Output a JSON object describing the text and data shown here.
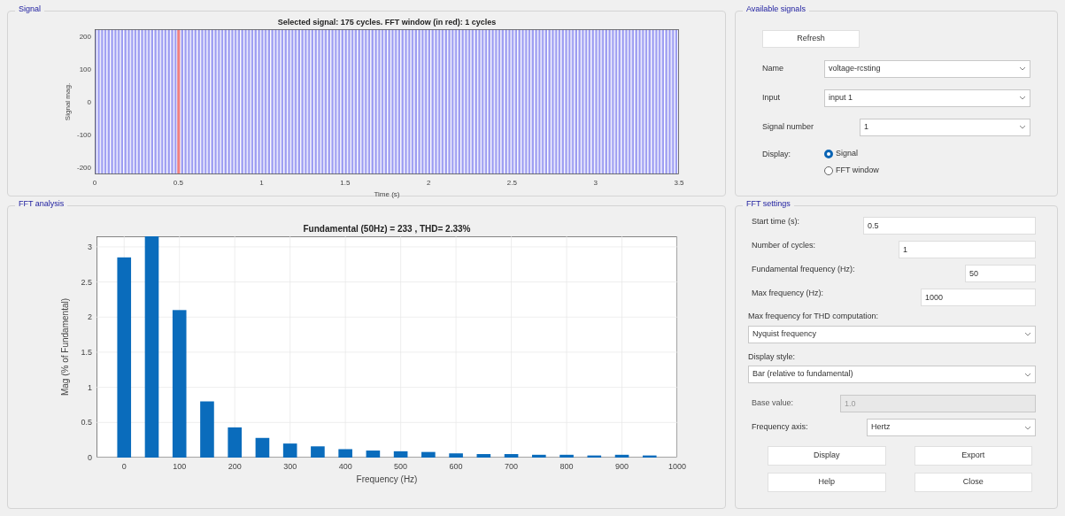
{
  "signal_panel": {
    "title": "Signal",
    "plot": {
      "title": "Selected signal: 175 cycles. FFT window (in red): 1 cycles",
      "ylabel": "Signal mag.",
      "xlabel": "Time (s)",
      "yticks": [
        "200",
        "100",
        "0",
        "-100",
        "-200"
      ],
      "xticks": [
        "0",
        "0.5",
        "1",
        "1.5",
        "2",
        "2.5",
        "3",
        "3.5"
      ]
    }
  },
  "available_signals": {
    "title": "Available signals",
    "refresh": "Refresh",
    "fields": [
      {
        "label": "Name",
        "value": "voltage-rcsting"
      },
      {
        "label": "Input",
        "value": "input 1"
      },
      {
        "label": "Signal number",
        "value": "1"
      }
    ],
    "display_label": "Display:",
    "display_options": [
      {
        "label": "Signal",
        "selected": true
      },
      {
        "label": "FFT window",
        "selected": false
      }
    ]
  },
  "fft_analysis": {
    "title": "FFT analysis",
    "chart_data": {
      "type": "bar",
      "title": "Fundamental (50Hz) = 233 , THD= 2.33%",
      "xlabel": "Frequency (Hz)",
      "ylabel": "Mag (% of Fundamental)",
      "x": [
        0,
        50,
        100,
        150,
        200,
        250,
        300,
        350,
        400,
        450,
        500,
        550,
        600,
        650,
        700,
        750,
        800,
        850,
        900,
        950
      ],
      "values": [
        2.85,
        3.15,
        2.1,
        0.8,
        0.43,
        0.28,
        0.2,
        0.16,
        0.12,
        0.1,
        0.09,
        0.08,
        0.06,
        0.05,
        0.05,
        0.04,
        0.04,
        0.03,
        0.04,
        0.03
      ],
      "xlim": [
        -50,
        1000
      ],
      "ylim": [
        0,
        3.15
      ],
      "xticks": [
        0,
        100,
        200,
        300,
        400,
        500,
        600,
        700,
        800,
        900,
        1000
      ],
      "yticks": [
        0,
        0.5,
        1,
        1.5,
        2,
        2.5,
        3
      ],
      "grid": true
    }
  },
  "fft_settings": {
    "title": "FFT settings",
    "inputs": [
      {
        "label": "Start time (s):",
        "value": "0.5"
      },
      {
        "label": "Number of cycles:",
        "value": "1"
      },
      {
        "label": "Fundamental frequency (Hz):",
        "value": "50"
      },
      {
        "label": "Max frequency (Hz):",
        "value": "1000"
      }
    ],
    "thd_label": "Max frequency for THD computation:",
    "thd_value": "Nyquist frequency",
    "style_label": "Display style:",
    "style_value": "Bar (relative to fundamental)",
    "base_label": "Base value:",
    "base_value": "1.0",
    "base_disabled": true,
    "axis_label": "Frequency axis:",
    "axis_value": "Hertz",
    "buttons": [
      "Display",
      "Export",
      "Help",
      "Close"
    ]
  }
}
